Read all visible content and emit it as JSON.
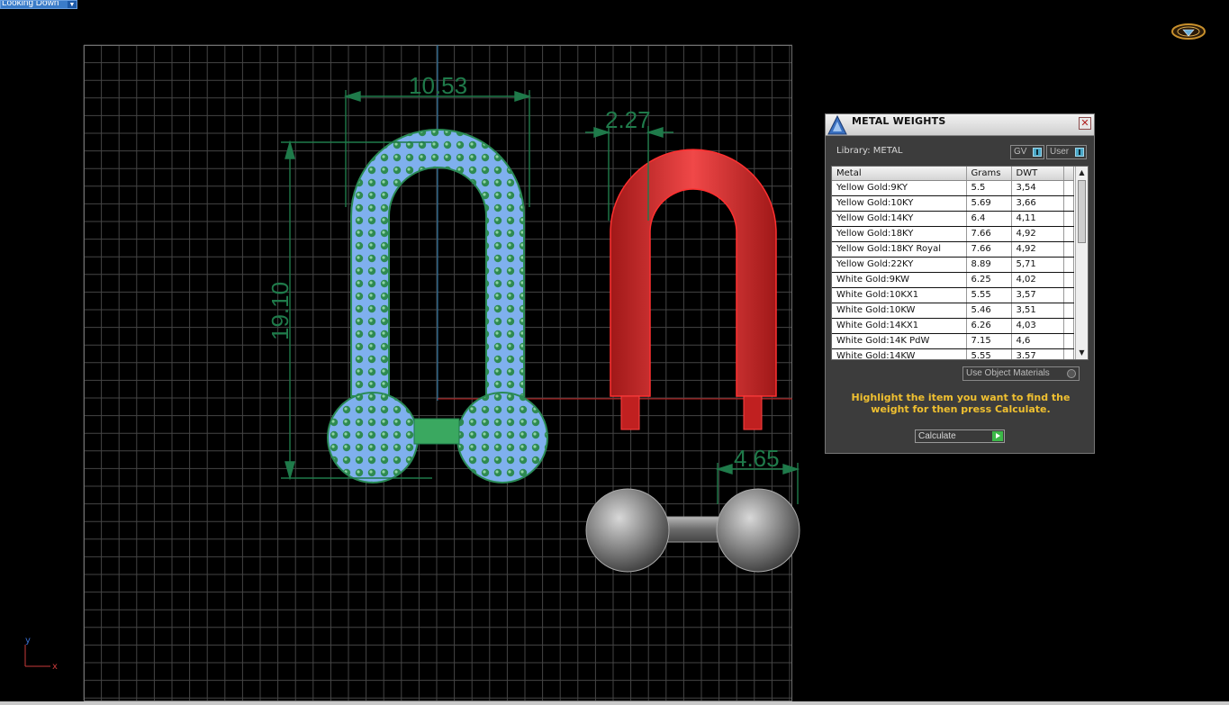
{
  "viewport": {
    "view_name": "Looking Down",
    "dimensions": [
      "10.53",
      "19.10",
      "2.27",
      "4.65"
    ],
    "axes": {
      "x": "x",
      "y": "y"
    },
    "colors": {
      "dimension": "#1f7a4a",
      "selection": "#7fb0ee",
      "gem": "#2a8a55",
      "red_part": "#d82424",
      "grid": "#4a4a4a"
    }
  },
  "panel": {
    "title": "METAL WEIGHTS",
    "library_label": "Library:  METAL",
    "toggle_gv": "GV",
    "toggle_user": "User",
    "columns": [
      "Metal",
      "Grams",
      "DWT"
    ],
    "rows": [
      [
        "Yellow Gold:9KY",
        "5.5",
        "3,54"
      ],
      [
        "Yellow Gold:10KY",
        "5.69",
        "3,66"
      ],
      [
        "Yellow Gold:14KY",
        "6.4",
        "4,11"
      ],
      [
        "Yellow Gold:18KY",
        "7.66",
        "4,92"
      ],
      [
        "Yellow Gold:18KY Royal",
        "7.66",
        "4,92"
      ],
      [
        "Yellow Gold:22KY",
        "8.89",
        "5,71"
      ],
      [
        "White Gold:9KW",
        "6.25",
        "4,02"
      ],
      [
        "White Gold:10KX1",
        "5.55",
        "3,57"
      ],
      [
        "White Gold:10KW",
        "5.46",
        "3,51"
      ],
      [
        "White Gold:14KX1",
        "6.26",
        "4,03"
      ],
      [
        "White Gold:14K PdW",
        "7.15",
        "4,6"
      ],
      [
        "White Gold:14KW",
        "5.55",
        "3.57"
      ]
    ],
    "use_object_materials": "Use Object Materials",
    "instructions": "Highlight the item you want to find the weight for then press Calculate.",
    "calculate_label": "Calculate"
  }
}
